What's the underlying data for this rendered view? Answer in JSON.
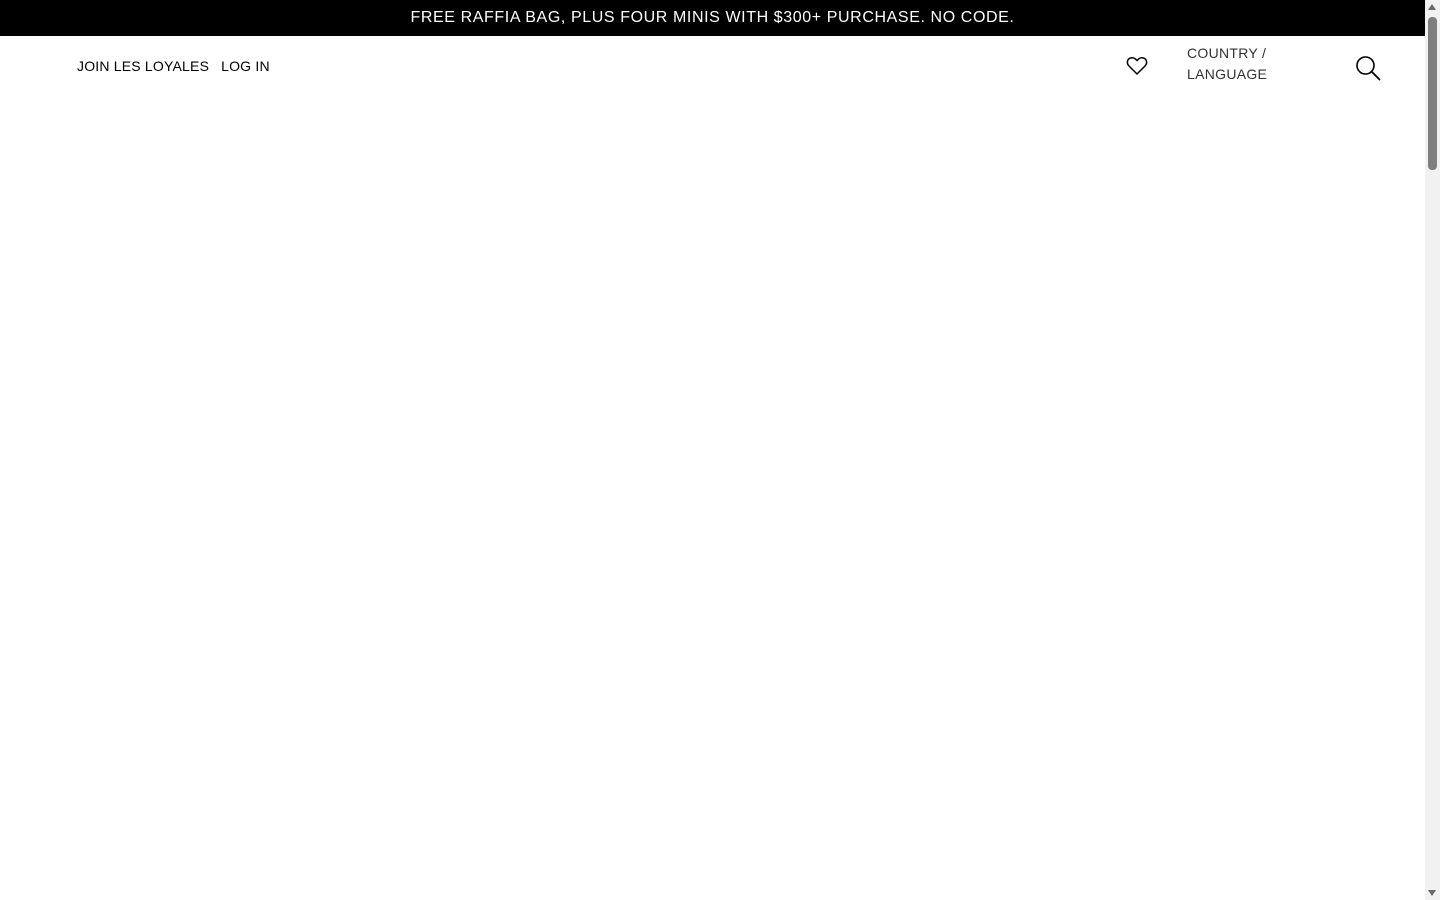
{
  "promo": {
    "text": "FREE RAFFIA BAG, PLUS FOUR MINIS WITH $300+ PURCHASE. NO CODE."
  },
  "header": {
    "join_label": "JOIN LES LOYALES",
    "login_label": "LOG IN",
    "wishlist_icon": "heart-icon",
    "country_line1": "COUNTRY /",
    "country_line2": "LANGUAGE",
    "search_icon": "search-icon"
  },
  "colors": {
    "promo_bg": "#000000",
    "promo_text": "#ffffff",
    "page_bg": "#ffffff"
  }
}
